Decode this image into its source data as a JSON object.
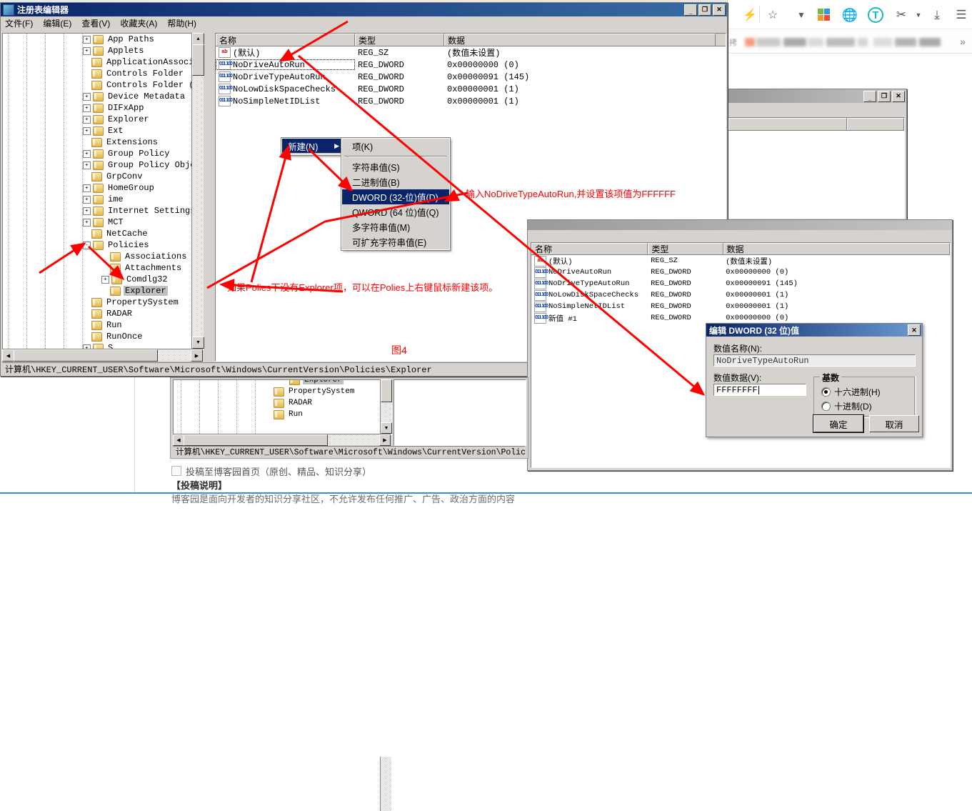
{
  "browser": {
    "icons": [
      "lightning-icon",
      "star-icon",
      "chevron-down-icon",
      "microsoft-icon",
      "globe-icon",
      "translate-icon",
      "scissors-icon",
      "download-icon",
      "hamburger-menu-icon"
    ],
    "bookmark_overflow": "»",
    "bookmark_label": "拷"
  },
  "regedit_main": {
    "title": "注册表编辑器",
    "menu": [
      "文件(F)",
      "编辑(E)",
      "查看(V)",
      "收藏夹(A)",
      "帮助(H)"
    ],
    "window_buttons": {
      "minimize": "_",
      "maximize": "□",
      "close": "✕"
    },
    "tree": [
      {
        "label": "App Paths",
        "indent": 0,
        "expander": "+",
        "selected": false
      },
      {
        "label": "Applets",
        "indent": 0,
        "expander": "+",
        "selected": false
      },
      {
        "label": "ApplicationAssociati",
        "indent": 0,
        "expander": "",
        "selected": false
      },
      {
        "label": "Controls Folder",
        "indent": 0,
        "expander": "",
        "selected": false
      },
      {
        "label": "Controls Folder (Wow",
        "indent": 0,
        "expander": "",
        "selected": false
      },
      {
        "label": "Device Metadata",
        "indent": 0,
        "expander": "+",
        "selected": false
      },
      {
        "label": "DIFxApp",
        "indent": 0,
        "expander": "+",
        "selected": false
      },
      {
        "label": "Explorer",
        "indent": 0,
        "expander": "+",
        "selected": false
      },
      {
        "label": "Ext",
        "indent": 0,
        "expander": "+",
        "selected": false
      },
      {
        "label": "Extensions",
        "indent": 0,
        "expander": "",
        "selected": false
      },
      {
        "label": "Group Policy",
        "indent": 0,
        "expander": "+",
        "selected": false
      },
      {
        "label": "Group Policy Objects",
        "indent": 0,
        "expander": "+",
        "selected": false
      },
      {
        "label": "GrpConv",
        "indent": 0,
        "expander": "",
        "selected": false
      },
      {
        "label": "HomeGroup",
        "indent": 0,
        "expander": "+",
        "selected": false
      },
      {
        "label": "ime",
        "indent": 0,
        "expander": "+",
        "selected": false
      },
      {
        "label": "Internet Settings",
        "indent": 0,
        "expander": "+",
        "selected": false
      },
      {
        "label": "MCT",
        "indent": 0,
        "expander": "+",
        "selected": false
      },
      {
        "label": "NetCache",
        "indent": 0,
        "expander": "",
        "selected": false
      },
      {
        "label": "Policies",
        "indent": 0,
        "expander": "-",
        "selected": false
      },
      {
        "label": "Associations",
        "indent": 1,
        "expander": "",
        "selected": false
      },
      {
        "label": "Attachments",
        "indent": 1,
        "expander": "",
        "selected": false
      },
      {
        "label": "Comdlg32",
        "indent": 1,
        "expander": "+",
        "selected": false
      },
      {
        "label": "Explorer",
        "indent": 1,
        "expander": "",
        "selected": true
      },
      {
        "label": "PropertySystem",
        "indent": 0,
        "expander": "",
        "selected": false
      },
      {
        "label": "RADAR",
        "indent": 0,
        "expander": "",
        "selected": false
      },
      {
        "label": "Run",
        "indent": 0,
        "expander": "",
        "selected": false
      },
      {
        "label": "RunOnce",
        "indent": 0,
        "expander": "",
        "selected": false
      },
      {
        "label": "S",
        "indent": 0,
        "expander": "+",
        "selected": false
      }
    ],
    "list": {
      "headers": [
        "名称",
        "类型",
        "数据"
      ],
      "rows": [
        {
          "icon": "ab",
          "name": "(默认)",
          "type": "REG_SZ",
          "data": "(数值未设置)",
          "focus": false
        },
        {
          "icon": "bin",
          "name": "NoDriveAutoRun",
          "type": "REG_DWORD",
          "data": "0x00000000  (0)",
          "focus": true
        },
        {
          "icon": "bin",
          "name": "NoDriveTypeAutoRun",
          "type": "REG_DWORD",
          "data": "0x00000091  (145)",
          "focus": false
        },
        {
          "icon": "bin",
          "name": "NoLowDiskSpaceChecks",
          "type": "REG_DWORD",
          "data": "0x00000001  (1)",
          "focus": false
        },
        {
          "icon": "bin",
          "name": "NoSimpleNetIDList",
          "type": "REG_DWORD",
          "data": "0x00000001  (1)",
          "focus": false
        }
      ]
    },
    "statusbar": "计算机\\HKEY_CURRENT_USER\\Software\\Microsoft\\Windows\\CurrentVersion\\Policies\\Explorer"
  },
  "context_menu": {
    "parent_item": "新建(N)",
    "parent_arrow": "▶",
    "items": [
      {
        "label": "项(K)",
        "highlight": false,
        "sep_after": true
      },
      {
        "label": "字符串值(S)",
        "highlight": false,
        "sep_after": false
      },
      {
        "label": "二进制值(B)",
        "highlight": false,
        "sep_after": false
      },
      {
        "label": "DWORD (32-位)值(D)",
        "highlight": true,
        "sep_after": false
      },
      {
        "label": "QWORD (64 位)值(Q)",
        "highlight": false,
        "sep_after": false
      },
      {
        "label": "多字符串值(M)",
        "highlight": false,
        "sep_after": false
      },
      {
        "label": "可扩充字符串值(E)",
        "highlight": false,
        "sep_after": false
      }
    ]
  },
  "annotations": {
    "note_right": "输入NoDriveTypeAutoRun,并设置该项值为FFFFFF",
    "note_left": "如果Polies下没有Explorer项，可以在Polies上右键鼠标新建该项。",
    "figure_label": "图4"
  },
  "regedit_second": {
    "window_buttons": {
      "minimize": "_",
      "maximize": "□",
      "close": "✕"
    },
    "list": {
      "headers": [
        "名称",
        "类型",
        "数据"
      ],
      "rows": [
        {
          "icon": "ab",
          "name": "(默认)",
          "type": "REG_SZ",
          "data": "(数值未设置)"
        },
        {
          "icon": "bin",
          "name": "NoDriveAutoRun",
          "type": "REG_DWORD",
          "data": "0x00000000  (0)"
        },
        {
          "icon": "bin",
          "name": "NoDriveTypeAutoRun",
          "type": "REG_DWORD",
          "data": "0x00000091  (145)"
        },
        {
          "icon": "bin",
          "name": "NoLowDiskSpaceChecks",
          "type": "REG_DWORD",
          "data": "0x00000001  (1)"
        },
        {
          "icon": "bin",
          "name": "NoSimpleNetIDList",
          "type": "REG_DWORD",
          "data": "0x00000001  (1)"
        },
        {
          "icon": "bin",
          "name": "新值 #1",
          "type": "REG_DWORD",
          "data": "0x00000000  (0)"
        }
      ]
    }
  },
  "edit_dialog": {
    "title": "编辑 DWORD (32 位)值",
    "close_label": "✕",
    "name_label": "数值名称(N):",
    "name_value": "NoDriveTypeAutoRun",
    "data_label": "数值数据(V):",
    "data_value": "FFFFFFFF",
    "base_group": "基数",
    "radio_hex": "十六进制(H)",
    "radio_dec": "十进制(D)",
    "radio_selected": "hex",
    "ok": "确定",
    "cancel": "取消"
  },
  "bg_window_bottom": {
    "tree": [
      {
        "label": "Explorer",
        "indent": 1,
        "selected": true
      },
      {
        "label": "PropertySystem",
        "indent": 0,
        "selected": false
      },
      {
        "label": "RADAR",
        "indent": 0,
        "selected": false
      },
      {
        "label": "Run",
        "indent": 0,
        "selected": false
      }
    ],
    "statusbar": "计算机\\HKEY_CURRENT_USER\\Software\\Microsoft\\Windows\\CurrentVersion\\Policies\\Explor"
  },
  "webpage": {
    "checkbox_label": "投稿至博客园首页（原创、精品、知识分享）",
    "link_label": "【投稿说明】",
    "body_text": "博客园是面向开发者的知识分享社区，不允许发布任何推广、广告、政治方面的内容"
  },
  "colors": {
    "accent_red": "#ff0000",
    "title_blue": "#0a246a",
    "chrome_face": "#d6d3ce",
    "select_gray": "#c0c0c0"
  }
}
